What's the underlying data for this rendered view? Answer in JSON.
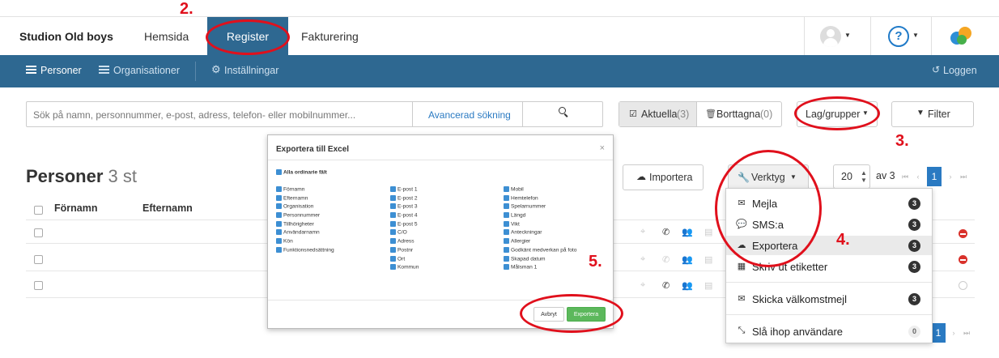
{
  "topnav": {
    "brand": "Studion Old boys",
    "links": [
      "Hemsida",
      "Register",
      "Fakturering"
    ],
    "active_link": "Register"
  },
  "subnav": {
    "items": [
      "Personer",
      "Organisationer",
      "Inställningar"
    ],
    "right": "Loggen"
  },
  "search": {
    "placeholder": "Sök på namn, personnummer, e-post, adress, telefon- eller mobilnummer...",
    "advanced": "Avancerad sökning"
  },
  "filters": {
    "current_label": "Aktuella",
    "current_count": "(3)",
    "deleted_label": "Borttagna",
    "deleted_count": "(0)",
    "groups": "Lag/grupper",
    "filter": "Filter"
  },
  "main": {
    "title": "Personer",
    "count": "3 st",
    "columns": [
      "Förnamn",
      "Efternamn"
    ]
  },
  "toolbar": {
    "import": "Importera",
    "tools": "Verktyg",
    "page_size": "20",
    "of_pages": "av 3",
    "current_page": "1"
  },
  "tools_menu": [
    {
      "label": "Mejla",
      "count": "3",
      "icon": "envelope-icon"
    },
    {
      "label": "SMS:a",
      "count": "3",
      "icon": "chat-bubble-icon"
    },
    {
      "label": "Exportera",
      "count": "3",
      "icon": "cloud-download-icon"
    },
    {
      "label": "Skriv ut etiketter",
      "count": "3",
      "icon": "grid-icon"
    },
    {
      "label": "Skicka välkomstmejl",
      "count": "3",
      "icon": "envelope-icon"
    },
    {
      "label": "Slå ihop användare",
      "count": "0",
      "icon": "compress-arrows-icon"
    }
  ],
  "modal": {
    "title": "Exportera till Excel",
    "all_fields": "Alla ordinarie fält",
    "col1": [
      "Förnamn",
      "Efternamn",
      "Organisation",
      "Personnummer",
      "Tillhörigheter",
      "Användarnamn",
      "Kön",
      "Funktionsnedsättning"
    ],
    "col2": [
      "E-post 1",
      "E-post 2",
      "E-post 3",
      "E-post 4",
      "E-post 5",
      "C/O",
      "Adress",
      "Postnr",
      "Ort",
      "Kommun"
    ],
    "col3": [
      "Mobil",
      "Hemtelefon",
      "Spelarnummer",
      "Längd",
      "Vikt",
      "Anteckningar",
      "Allergier",
      "Godkänt medverkan på foto",
      "Skapad datum",
      "Målsman 1"
    ],
    "cancel": "Avbryt",
    "export": "Exportera"
  },
  "annotations": [
    "2.",
    "3.",
    "4.",
    "5."
  ]
}
